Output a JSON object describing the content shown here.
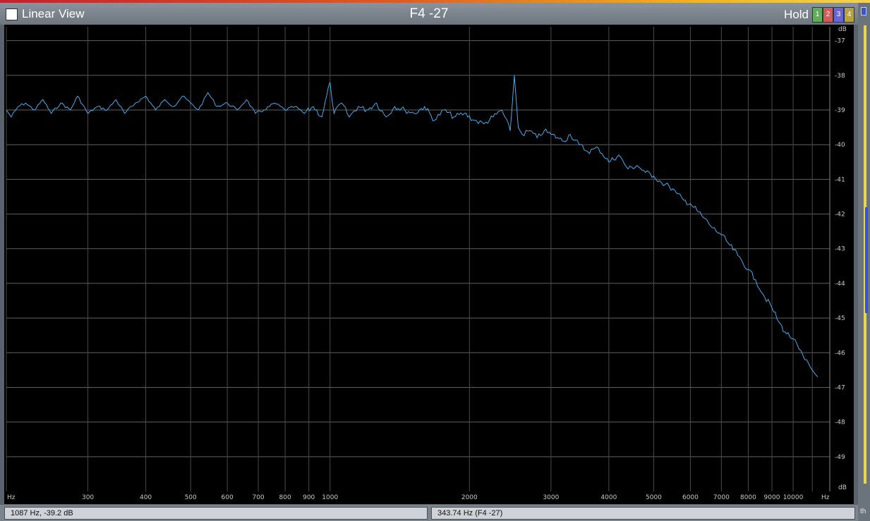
{
  "header": {
    "linear_view_label": "Linear View",
    "title": "F4 -27",
    "hold_label": "Hold",
    "hold_buttons": [
      {
        "label": "1",
        "color": "#5fae57"
      },
      {
        "label": "2",
        "color": "#d45a5a"
      },
      {
        "label": "3",
        "color": "#6a64d6"
      },
      {
        "label": "4",
        "color": "#b6a33e"
      }
    ]
  },
  "status": {
    "cursor": "1087 Hz,  -39.2 dB",
    "peak": "343.74 Hz (F4 -27)",
    "right_fragment": "th"
  },
  "chart_data": {
    "type": "line",
    "x_scale": "log",
    "xlim": [
      200,
      12000
    ],
    "ylim": [
      -50,
      -36.6
    ],
    "grid": true,
    "x_ticks": [
      300,
      400,
      500,
      600,
      700,
      800,
      900,
      1000,
      2000,
      3000,
      4000,
      5000,
      6000,
      7000,
      8000,
      9000,
      10000
    ],
    "x_tick_labels": [
      "300",
      "400",
      "500",
      "600",
      "700",
      "800",
      "900",
      "1000",
      "2000",
      "3000",
      "4000",
      "5000",
      "6000",
      "7000",
      "8000",
      "9000",
      "10000"
    ],
    "y_ticks": [
      -37,
      -38,
      -39,
      -40,
      -41,
      -42,
      -43,
      -44,
      -45,
      -46,
      -47,
      -48,
      -49
    ],
    "y_tick_labels": [
      "-37",
      "-38",
      "-39",
      "-40",
      "-41",
      "-42",
      "-43",
      "-44",
      "-45",
      "-46",
      "-47",
      "-48",
      "-49"
    ],
    "x_unit_left": "Hz",
    "x_unit_right": "Hz",
    "y_unit_top": "dB",
    "y_unit_bottom": "dB",
    "line_color": "#4aa8e6",
    "series": [
      {
        "x": [
          200,
          205,
          212,
          220,
          230,
          240,
          250,
          262,
          275,
          285,
          300,
          315,
          330,
          345,
          360,
          380,
          400,
          420,
          440,
          460,
          480,
          500,
          520,
          545,
          570,
          600,
          630,
          660,
          690,
          720,
          760,
          800,
          840,
          880,
          920,
          960,
          1000,
          1020,
          1060,
          1100,
          1150,
          1200,
          1260,
          1320,
          1380,
          1450,
          1520,
          1600,
          1680,
          1760,
          1850,
          1950,
          2050,
          2150,
          2250,
          2350,
          2450,
          2500,
          2550,
          2600,
          2700,
          2800,
          2900,
          3000,
          3100,
          3200,
          3300,
          3450,
          3600,
          3800,
          4000,
          4200,
          4400,
          4600,
          4800,
          5000,
          5200,
          5400,
          5600,
          5800,
          6000,
          6200,
          6400,
          6700,
          7000,
          7300,
          7600,
          8000,
          8300,
          8600,
          9000,
          9300,
          9600,
          10000,
          10300,
          10600,
          11000,
          11300
        ],
        "y": [
          -39.0,
          -39.2,
          -38.9,
          -38.8,
          -39.0,
          -38.7,
          -39.1,
          -38.8,
          -39.0,
          -38.6,
          -39.1,
          -38.9,
          -39.0,
          -38.7,
          -39.1,
          -38.8,
          -38.6,
          -39.0,
          -38.7,
          -38.9,
          -38.6,
          -38.8,
          -39.0,
          -38.5,
          -38.9,
          -38.8,
          -39.0,
          -38.7,
          -39.1,
          -39.0,
          -38.8,
          -39.0,
          -38.9,
          -39.1,
          -38.9,
          -39.2,
          -38.2,
          -39.1,
          -38.8,
          -39.2,
          -38.9,
          -39.0,
          -38.8,
          -39.2,
          -38.9,
          -39.0,
          -39.1,
          -38.9,
          -39.3,
          -39.0,
          -39.2,
          -39.1,
          -39.3,
          -39.4,
          -39.2,
          -39.0,
          -39.6,
          -38.0,
          -39.5,
          -39.7,
          -39.6,
          -39.8,
          -39.6,
          -39.7,
          -39.8,
          -39.9,
          -39.7,
          -40.0,
          -40.2,
          -40.1,
          -40.5,
          -40.3,
          -40.7,
          -40.6,
          -40.8,
          -40.9,
          -41.1,
          -41.2,
          -41.4,
          -41.6,
          -41.7,
          -41.9,
          -42.1,
          -42.4,
          -42.6,
          -42.9,
          -43.2,
          -43.6,
          -43.9,
          -44.3,
          -44.7,
          -45.1,
          -45.4,
          -45.6,
          -45.9,
          -46.2,
          -46.5,
          -46.7
        ]
      }
    ]
  }
}
